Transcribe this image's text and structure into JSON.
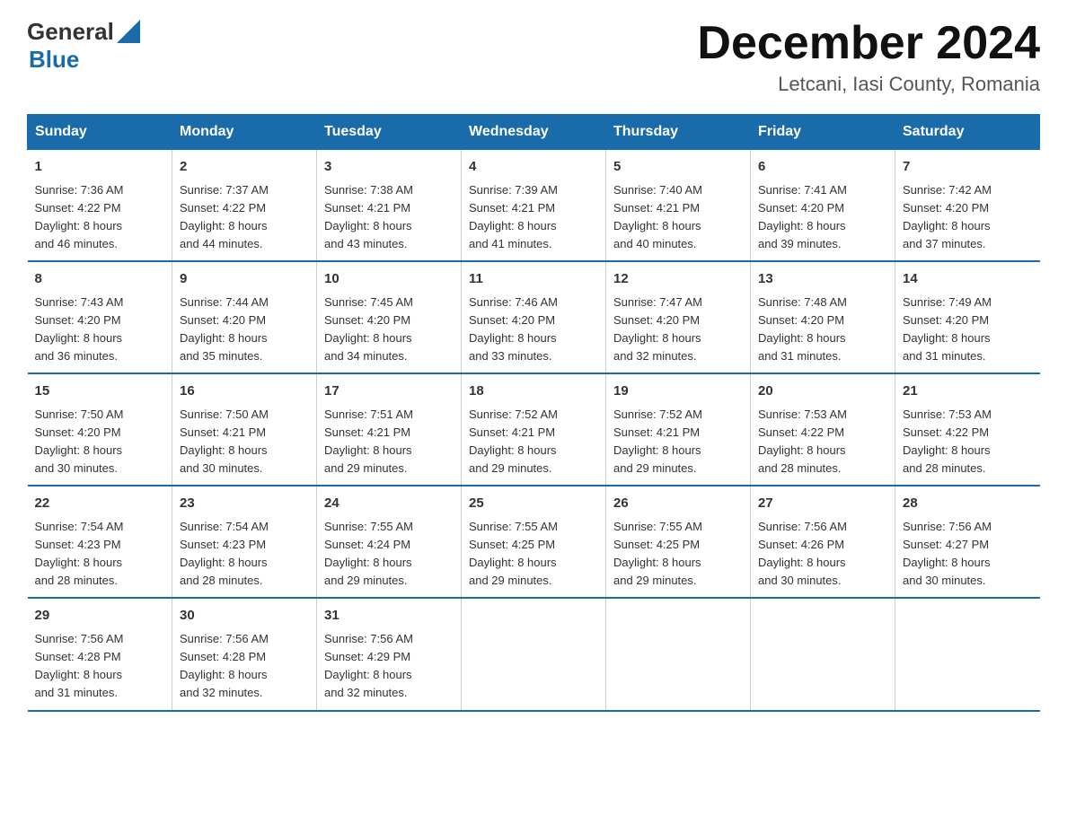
{
  "header": {
    "logo_general": "General",
    "logo_blue": "Blue",
    "title": "December 2024",
    "subtitle": "Letcani, Iasi County, Romania"
  },
  "columns": [
    "Sunday",
    "Monday",
    "Tuesday",
    "Wednesday",
    "Thursday",
    "Friday",
    "Saturday"
  ],
  "weeks": [
    [
      {
        "day": "1",
        "sunrise": "7:36 AM",
        "sunset": "4:22 PM",
        "daylight": "8 hours and 46 minutes."
      },
      {
        "day": "2",
        "sunrise": "7:37 AM",
        "sunset": "4:22 PM",
        "daylight": "8 hours and 44 minutes."
      },
      {
        "day": "3",
        "sunrise": "7:38 AM",
        "sunset": "4:21 PM",
        "daylight": "8 hours and 43 minutes."
      },
      {
        "day": "4",
        "sunrise": "7:39 AM",
        "sunset": "4:21 PM",
        "daylight": "8 hours and 41 minutes."
      },
      {
        "day": "5",
        "sunrise": "7:40 AM",
        "sunset": "4:21 PM",
        "daylight": "8 hours and 40 minutes."
      },
      {
        "day": "6",
        "sunrise": "7:41 AM",
        "sunset": "4:20 PM",
        "daylight": "8 hours and 39 minutes."
      },
      {
        "day": "7",
        "sunrise": "7:42 AM",
        "sunset": "4:20 PM",
        "daylight": "8 hours and 37 minutes."
      }
    ],
    [
      {
        "day": "8",
        "sunrise": "7:43 AM",
        "sunset": "4:20 PM",
        "daylight": "8 hours and 36 minutes."
      },
      {
        "day": "9",
        "sunrise": "7:44 AM",
        "sunset": "4:20 PM",
        "daylight": "8 hours and 35 minutes."
      },
      {
        "day": "10",
        "sunrise": "7:45 AM",
        "sunset": "4:20 PM",
        "daylight": "8 hours and 34 minutes."
      },
      {
        "day": "11",
        "sunrise": "7:46 AM",
        "sunset": "4:20 PM",
        "daylight": "8 hours and 33 minutes."
      },
      {
        "day": "12",
        "sunrise": "7:47 AM",
        "sunset": "4:20 PM",
        "daylight": "8 hours and 32 minutes."
      },
      {
        "day": "13",
        "sunrise": "7:48 AM",
        "sunset": "4:20 PM",
        "daylight": "8 hours and 31 minutes."
      },
      {
        "day": "14",
        "sunrise": "7:49 AM",
        "sunset": "4:20 PM",
        "daylight": "8 hours and 31 minutes."
      }
    ],
    [
      {
        "day": "15",
        "sunrise": "7:50 AM",
        "sunset": "4:20 PM",
        "daylight": "8 hours and 30 minutes."
      },
      {
        "day": "16",
        "sunrise": "7:50 AM",
        "sunset": "4:21 PM",
        "daylight": "8 hours and 30 minutes."
      },
      {
        "day": "17",
        "sunrise": "7:51 AM",
        "sunset": "4:21 PM",
        "daylight": "8 hours and 29 minutes."
      },
      {
        "day": "18",
        "sunrise": "7:52 AM",
        "sunset": "4:21 PM",
        "daylight": "8 hours and 29 minutes."
      },
      {
        "day": "19",
        "sunrise": "7:52 AM",
        "sunset": "4:21 PM",
        "daylight": "8 hours and 29 minutes."
      },
      {
        "day": "20",
        "sunrise": "7:53 AM",
        "sunset": "4:22 PM",
        "daylight": "8 hours and 28 minutes."
      },
      {
        "day": "21",
        "sunrise": "7:53 AM",
        "sunset": "4:22 PM",
        "daylight": "8 hours and 28 minutes."
      }
    ],
    [
      {
        "day": "22",
        "sunrise": "7:54 AM",
        "sunset": "4:23 PM",
        "daylight": "8 hours and 28 minutes."
      },
      {
        "day": "23",
        "sunrise": "7:54 AM",
        "sunset": "4:23 PM",
        "daylight": "8 hours and 28 minutes."
      },
      {
        "day": "24",
        "sunrise": "7:55 AM",
        "sunset": "4:24 PM",
        "daylight": "8 hours and 29 minutes."
      },
      {
        "day": "25",
        "sunrise": "7:55 AM",
        "sunset": "4:25 PM",
        "daylight": "8 hours and 29 minutes."
      },
      {
        "day": "26",
        "sunrise": "7:55 AM",
        "sunset": "4:25 PM",
        "daylight": "8 hours and 29 minutes."
      },
      {
        "day": "27",
        "sunrise": "7:56 AM",
        "sunset": "4:26 PM",
        "daylight": "8 hours and 30 minutes."
      },
      {
        "day": "28",
        "sunrise": "7:56 AM",
        "sunset": "4:27 PM",
        "daylight": "8 hours and 30 minutes."
      }
    ],
    [
      {
        "day": "29",
        "sunrise": "7:56 AM",
        "sunset": "4:28 PM",
        "daylight": "8 hours and 31 minutes."
      },
      {
        "day": "30",
        "sunrise": "7:56 AM",
        "sunset": "4:28 PM",
        "daylight": "8 hours and 32 minutes."
      },
      {
        "day": "31",
        "sunrise": "7:56 AM",
        "sunset": "4:29 PM",
        "daylight": "8 hours and 32 minutes."
      },
      null,
      null,
      null,
      null
    ]
  ],
  "labels": {
    "sunrise": "Sunrise:",
    "sunset": "Sunset:",
    "daylight": "Daylight:"
  },
  "colors": {
    "header_bg": "#1a6baa",
    "border": "#1a6baa"
  }
}
